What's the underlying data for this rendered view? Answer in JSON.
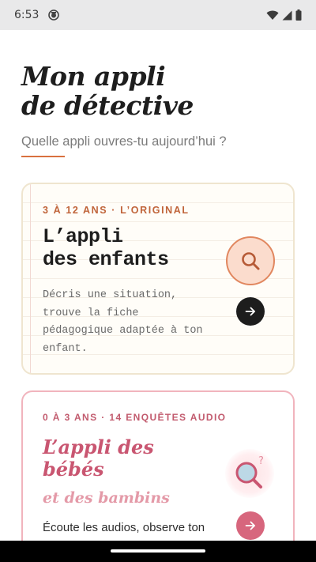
{
  "status_bar": {
    "time": "6:53",
    "icons": [
      "app-notification-icon",
      "wifi-icon",
      "signal-icon",
      "battery-icon"
    ]
  },
  "header": {
    "title_line1": "Mon appli",
    "title_line2": "de détective",
    "subtitle": "Quelle appli ouvres-tu aujourd’hui ?"
  },
  "cards": [
    {
      "kicker": "3 À 12 ANS · L’ORIGINAL",
      "title_line1": "L’appli",
      "title_line2": "des enfants",
      "description": "Décris une situation, trouve la fiche pédagogique adaptée à ton enfant.",
      "icon": "magnifier-icon",
      "accent": "#c0643a"
    },
    {
      "kicker": "0 À 3 ANS · 14 ENQUÊTES AUDIO",
      "title_line1": "L’appli des",
      "title_line2": "bébés",
      "subtitle": "et des bambins",
      "description": "Écoute les audios, observe ton",
      "icon": "magnifier-question-icon",
      "accent": "#c95671"
    }
  ],
  "colors": {
    "orange_accent": "#d9713f",
    "pink_accent": "#d7667d",
    "dark": "#1d1d1d"
  }
}
